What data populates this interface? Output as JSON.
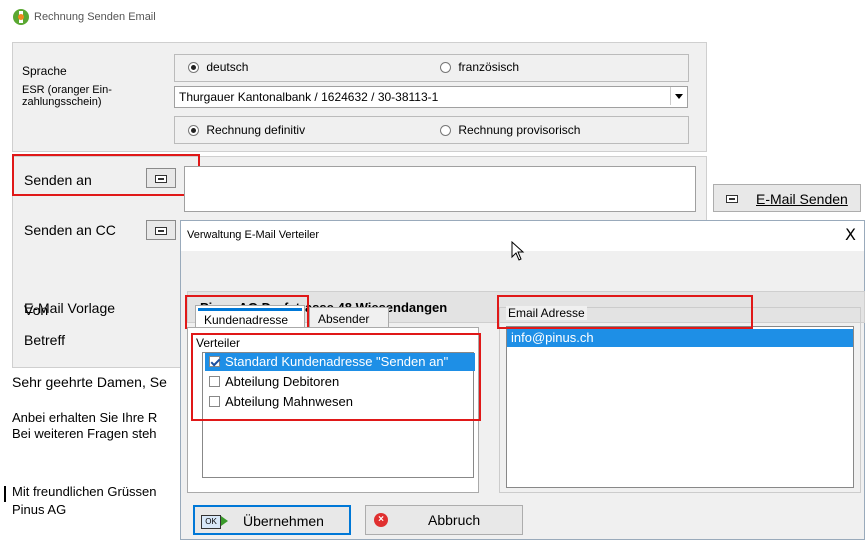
{
  "window": {
    "title": "Rechnung Senden Email"
  },
  "form": {
    "sprache_label": "Sprache",
    "lang_de": "deutsch",
    "lang_fr": "französisch",
    "esr_label": "ESR (oranger Ein-\nzahlungsschein)",
    "esr_value": "Thurgauer Kantonalbank / 1624632 / 30-38113-1",
    "rechnung_def": "Rechnung definitiv",
    "rechnung_prov": "Rechnung provisorisch",
    "senden_an_label": "Senden an",
    "senden_cc_label": "Senden an CC",
    "von_label": "Von",
    "vorlage_label": "E-Mail Vorlage",
    "betreff_label": "Betreff",
    "send_button": "E-Mail Senden"
  },
  "body_text": {
    "line1": "Sehr geehrte Damen, Se",
    "line2": "Anbei erhalten Sie Ihre R",
    "line3": "Bei weiteren Fragen steh",
    "line4": "Mit freundlichen Grüssen",
    "line5": "Pinus AG"
  },
  "dialog": {
    "title": "Verwaltung E-Mail Verteiler",
    "close": "X",
    "company": "Pinus AG Dorfstrasse 48 Wiesendangen",
    "tabs": [
      "Kundenadresse",
      "Absender"
    ],
    "verteiler_label": "Verteiler",
    "items": [
      {
        "label": "Standard Kundenadresse \"Senden an\"",
        "checked": true
      },
      {
        "label": "Abteilung Debitoren",
        "checked": false
      },
      {
        "label": "Abteilung Mahnwesen",
        "checked": false
      }
    ],
    "email_label": "Email Adresse",
    "emails": [
      "info@pinus.ch"
    ],
    "ok_button": "Übernehmen",
    "cancel_button": "Abbruch",
    "ok_badge": "OK"
  },
  "colors": {
    "highlight": "#0078d7",
    "annotation": "#e01818",
    "list_select": "#1e8fe6"
  }
}
